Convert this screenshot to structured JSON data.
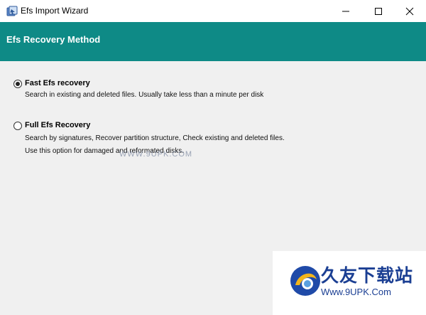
{
  "window": {
    "title": "Efs Import Wizard",
    "icon": "wizard-app-icon",
    "controls": [
      "minimize-icon",
      "maximize-icon",
      "close-icon"
    ]
  },
  "header": {
    "title": "Efs Recovery Method",
    "background": "#0e8a86"
  },
  "options": [
    {
      "label": "Fast Efs recovery",
      "selected": true,
      "description": [
        "Search in existing and deleted files. Usually take less than a minute per disk"
      ]
    },
    {
      "label": "Full Efs Recovery",
      "selected": false,
      "description": [
        "Search by signatures, Recover partition structure, Check existing and deleted files.",
        "Use this option for damaged and reformated disks."
      ]
    }
  ],
  "watermark": {
    "text": "WWW.9UPK.COM"
  },
  "logo": {
    "name": "久友下载站",
    "url": "Www.9UPK.Com",
    "brand_color": "#1b3f93"
  }
}
